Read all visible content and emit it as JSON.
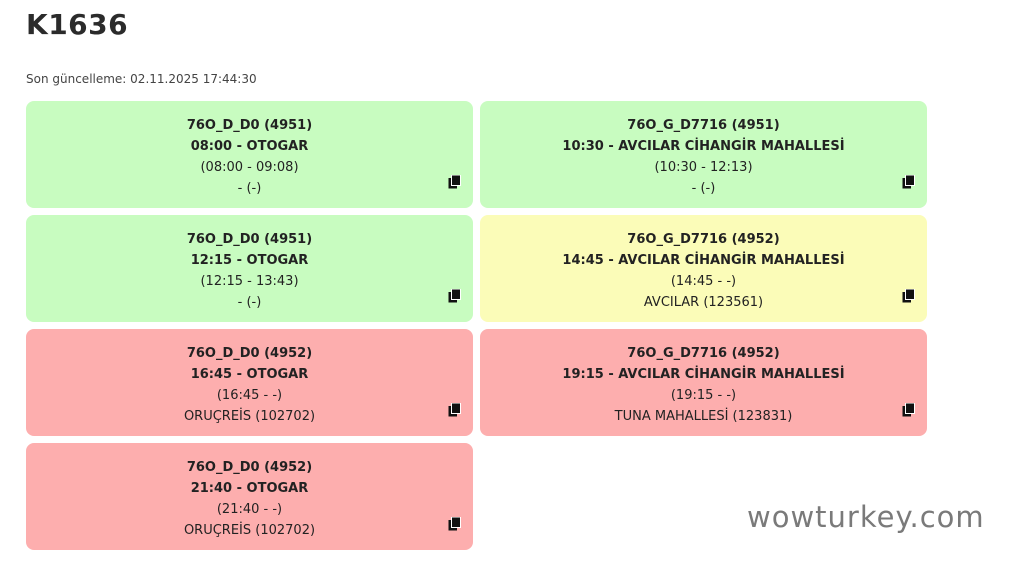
{
  "page": {
    "title": "K1636",
    "last_updated": "Son güncelleme: 02.11.2025 17:44:30"
  },
  "colors": {
    "green": "#c8fcc0",
    "yellow": "#fbfcb8",
    "red": "#fdaeae"
  },
  "cards": [
    {
      "status": "green",
      "route": "76O_D_D0 (4951)",
      "departure": "08:00 - OTOGAR",
      "time_range": "(08:00 - 09:08)",
      "stop": "- (-)",
      "icon": "copy-icon"
    },
    {
      "status": "green",
      "route": "76O_G_D7716 (4951)",
      "departure": "10:30 - AVCILAR CİHANGİR MAHALLESİ",
      "time_range": "(10:30 - 12:13)",
      "stop": "- (-)",
      "icon": "copy-icon"
    },
    {
      "status": "green",
      "route": "76O_D_D0 (4951)",
      "departure": "12:15 - OTOGAR",
      "time_range": "(12:15 - 13:43)",
      "stop": "- (-)",
      "icon": "copy-icon"
    },
    {
      "status": "yellow",
      "route": "76O_G_D7716 (4952)",
      "departure": "14:45 - AVCILAR CİHANGİR MAHALLESİ",
      "time_range": "(14:45 - -)",
      "stop": "AVCILAR (123561)",
      "icon": "copy-icon"
    },
    {
      "status": "red",
      "route": "76O_D_D0 (4952)",
      "departure": "16:45 - OTOGAR",
      "time_range": "(16:45 - -)",
      "stop": "ORUÇREİS (102702)",
      "icon": "copy-icon"
    },
    {
      "status": "red",
      "route": "76O_G_D7716 (4952)",
      "departure": "19:15 - AVCILAR CİHANGİR MAHALLESİ",
      "time_range": "(19:15 - -)",
      "stop": "TUNA MAHALLESİ (123831)",
      "icon": "copy-icon"
    },
    {
      "status": "red",
      "route": "76O_D_D0 (4952)",
      "departure": "21:40 - OTOGAR",
      "time_range": "(21:40 - -)",
      "stop": "ORUÇREİS (102702)",
      "icon": "copy-icon"
    }
  ],
  "watermark": "wowturkey.com"
}
